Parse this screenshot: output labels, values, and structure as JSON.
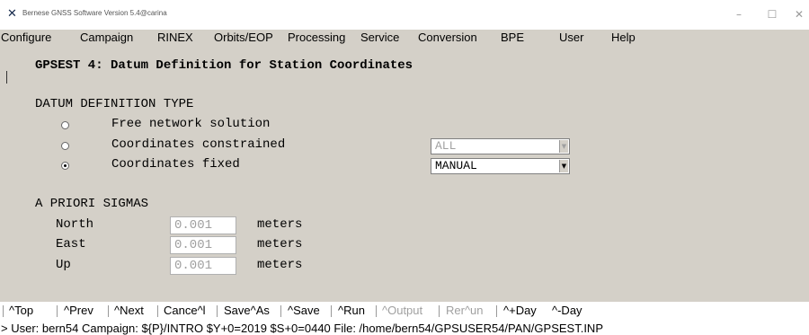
{
  "window": {
    "title": "Bernese GNSS Software Version 5.4@carina",
    "icon": "x-logo-icon"
  },
  "menubar": {
    "items": [
      "Configure",
      "Campaign",
      "RINEX",
      "Orbits/EOP",
      "Processing",
      "Service",
      "Conversion",
      "BPE",
      "User",
      "Help"
    ]
  },
  "panel": {
    "title": "GPSEST 4: Datum Definition for Station Coordinates",
    "datum_section": "DATUM DEFINITION TYPE",
    "options": [
      {
        "label": "Free network solution",
        "selected": false
      },
      {
        "label": "Coordinates constrained",
        "selected": false
      },
      {
        "label": "Coordinates fixed",
        "selected": true
      }
    ],
    "constrained_select": "ALL",
    "fixed_select": "MANUAL",
    "sigma_section": "A PRIORI SIGMAS",
    "sigmas": [
      {
        "label": "North",
        "value": "0.001",
        "unit": "meters"
      },
      {
        "label": "East",
        "value": "0.001",
        "unit": "meters"
      },
      {
        "label": "Up",
        "value": "0.001",
        "unit": "meters"
      }
    ]
  },
  "buttons": [
    "^Top",
    "^Prev",
    "^Next",
    "Cance^l",
    "Save^As",
    "^Save",
    "^Run",
    "^Output",
    "Rer^un",
    "^+Day",
    "^-Day"
  ],
  "status": "> User: bern54  Campaign: ${P}/INTRO  $Y+0=2019  $S+0=0440  File: /home/bern54/GPSUSER54/PAN/GPSEST.INP"
}
